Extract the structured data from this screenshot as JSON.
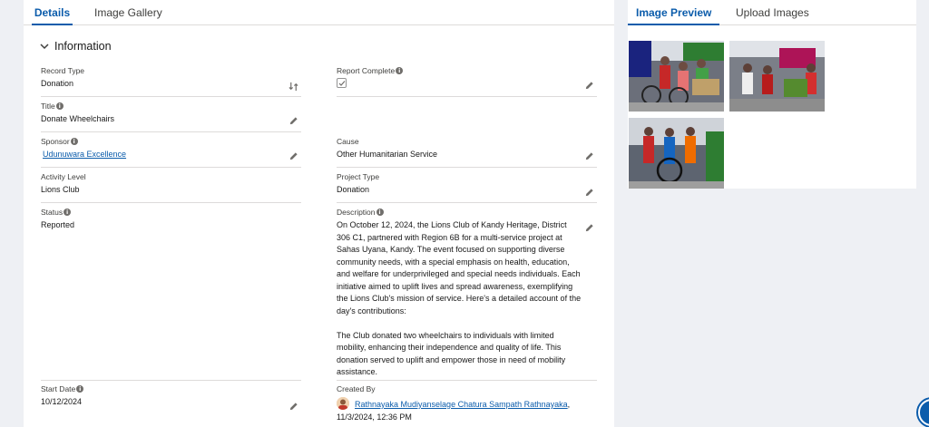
{
  "tabs": [
    "Details",
    "Image Gallery"
  ],
  "section_title": "Information",
  "fields": {
    "record_type": {
      "label": "Record Type",
      "value": "Donation"
    },
    "report_complete": {
      "label": "Report Complete",
      "checked": true
    },
    "title": {
      "label": "Title",
      "value": "Donate Wheelchairs"
    },
    "sponsor": {
      "label": "Sponsor",
      "value": "Udunuwara Excellence"
    },
    "cause": {
      "label": "Cause",
      "value": "Other Humanitarian Service"
    },
    "activity_level": {
      "label": "Activity Level",
      "value": "Lions Club"
    },
    "project_type": {
      "label": "Project Type",
      "value": "Donation"
    },
    "status": {
      "label": "Status",
      "value": "Reported"
    },
    "description": {
      "label": "Description",
      "value": "On October 12, 2024, the Lions Club of Kandy Heritage, District 306 C1, partnered with Region 6B for a multi-service project at Sahas Uyana, Kandy. The event focused on supporting diverse community needs, with a special emphasis on health, education, and welfare for underprivileged and special needs individuals. Each initiative aimed to uplift lives and spread awareness, exemplifying the Lions Club's mission of service. Here's a detailed account of the day's contributions:\n\nThe Club donated two wheelchairs to individuals with limited mobility, enhancing their independence and quality of life. This donation served to uplift and empower those in need of mobility assistance."
    },
    "start_date": {
      "label": "Start Date",
      "value": "10/12/2024"
    },
    "created_by": {
      "label": "Created By",
      "user": "Rathnayaka Mudiyanselage Chatura Sampath Rathnayaka",
      "separator": ",",
      "datetime": "11/3/2024, 12:36 PM"
    }
  },
  "side_tabs": [
    "Image Preview",
    "Upload Images"
  ],
  "images": [
    "photo-1",
    "photo-2",
    "photo-3"
  ],
  "colors": {
    "brand": "#0b5cab",
    "label": "#3e3e3c",
    "divider": "#dddbda"
  }
}
